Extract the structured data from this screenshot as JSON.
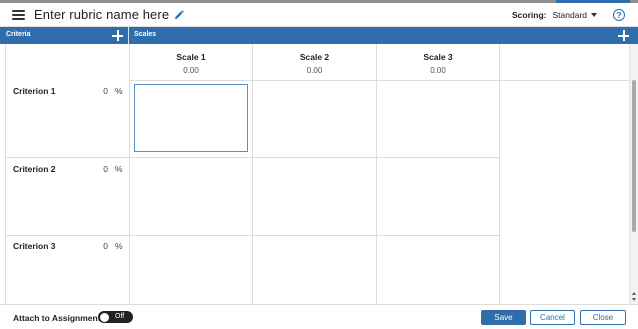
{
  "header": {
    "title": "Enter rubric name here",
    "scoring_label": "Scoring:",
    "scoring_value": "Standard",
    "help_glyph": "?"
  },
  "section_bar": {
    "criteria_label": "Criteria",
    "scales_label": "Scales"
  },
  "scales": [
    {
      "name": "Scale 1",
      "points": "0.00"
    },
    {
      "name": "Scale 2",
      "points": "0.00"
    },
    {
      "name": "Scale 3",
      "points": "0.00"
    }
  ],
  "criteria": [
    {
      "name": "Criterion 1",
      "percent": "0",
      "percent_sign": "%"
    },
    {
      "name": "Criterion 2",
      "percent": "0",
      "percent_sign": "%"
    },
    {
      "name": "Criterion 3",
      "percent": "0",
      "percent_sign": "%"
    }
  ],
  "footer": {
    "attach_label": "Attach to Assignment",
    "toggle_state": "Off",
    "save_label": "Save",
    "cancel_label": "Cancel",
    "close_label": "Close"
  },
  "icons": {
    "menu": "hamburger-menu-icon",
    "edit": "pencil-icon",
    "help": "question-circle-icon",
    "add": "plus-icon"
  },
  "colors": {
    "accent": "#2f6eaa",
    "grid_line": "#dcdcdc",
    "selected_cell_border": "#5b8fc7"
  }
}
